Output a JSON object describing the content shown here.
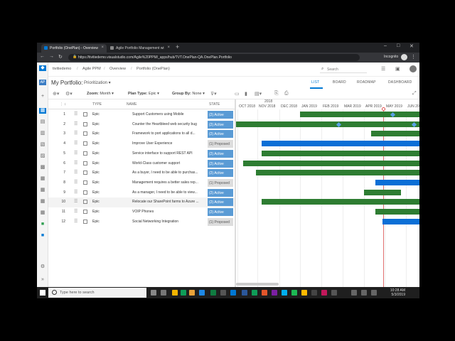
{
  "browser": {
    "tabs": [
      {
        "title": "Portfolio (OnePlan) - Overview"
      },
      {
        "title": "Agile Portfolio Management wi"
      }
    ],
    "url": "https://tivitiedemo.visualstudio.com/Agile%20PPM/_apps/hub/TVT.OnePlan-QA.OnePlan.Portfolio",
    "profile_label": "Incognito"
  },
  "nav": {
    "breadcrumbs": [
      "tivitiedemo",
      "Agile PPM",
      "Overview",
      "Portfolio (OnePlan)"
    ],
    "search_placeholder": "Search"
  },
  "header": {
    "title": "My Portfolio:",
    "view": "Prioritization",
    "view_tabs": [
      "LIST",
      "BOARD",
      "ROADMAP",
      "DASHBOARD"
    ]
  },
  "toolbar": {
    "zoom_label": "Zoom:",
    "zoom_value": "Month",
    "plan_type_label": "Plan Type:",
    "plan_type_value": "Epic",
    "group_by_label": "Group By:",
    "group_by_value": "None"
  },
  "grid": {
    "headers": {
      "type": "TYPE",
      "name": "NAME",
      "state": "STATE"
    },
    "rows": [
      {
        "n": "1",
        "type": "Epic",
        "name": "Support Customers using Mobile",
        "state": "(2) Active"
      },
      {
        "n": "2",
        "type": "Epic",
        "name": "Counter the Heartbleed web security bug",
        "state": "(2) Active"
      },
      {
        "n": "3",
        "type": "Epic",
        "name": "Framework to port applications to all d...",
        "state": "(2) Active"
      },
      {
        "n": "4",
        "type": "Epic",
        "name": "Improve User Experience",
        "state": "(1) Proposed"
      },
      {
        "n": "5",
        "type": "Epic",
        "name": "Service interface to support REST API",
        "state": "(2) Active"
      },
      {
        "n": "6",
        "type": "Epic",
        "name": "World-Class customer support",
        "state": "(2) Active"
      },
      {
        "n": "7",
        "type": "Epic",
        "name": "As a buyer, I need to be able to purchas...",
        "state": "(2) Active"
      },
      {
        "n": "8",
        "type": "Epic",
        "name": "Management requires a better sales rep...",
        "state": "(1) Proposed"
      },
      {
        "n": "9",
        "type": "Epic",
        "name": "As a manager, I need to be able to view...",
        "state": "(2) Active"
      },
      {
        "n": "10",
        "type": "Epic",
        "name": "Relocate our SharePoint farms to Azure ...",
        "state": "(2) Active"
      },
      {
        "n": "11",
        "type": "Epic",
        "name": "VOIP Phones",
        "state": "(2) Active"
      },
      {
        "n": "12",
        "type": "Epic",
        "name": "Social Networking Integration",
        "state": "(1) Proposed"
      }
    ]
  },
  "gantt": {
    "year": "2018",
    "months": [
      "OCT 2018",
      "NOV 2018",
      "DEC 2018",
      "JAN 2019",
      "FEB 2019",
      "MAR 2019",
      "APR 2019",
      "MAY 2019",
      "JUN 20"
    ]
  },
  "taskbar": {
    "search_placeholder": "Type here to search",
    "time": "10:28 AM",
    "date": "5/3/2019"
  }
}
